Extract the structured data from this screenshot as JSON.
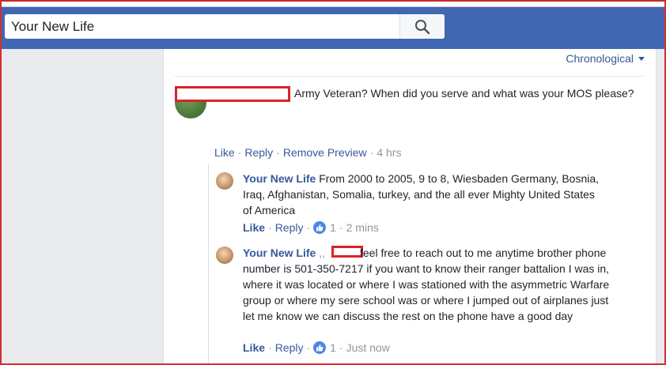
{
  "search": {
    "value": "Your New Life"
  },
  "sort": {
    "label": "Chronological"
  },
  "comment": {
    "text": "Army Veteran? When did you serve and what was your MOS please?",
    "actions": {
      "like": "Like",
      "reply": "Reply",
      "remove_preview": "Remove Preview",
      "time": "4 hrs"
    }
  },
  "replies": [
    {
      "author": "Your New Life",
      "text": "From 2000 to 2005, 9 to 8, Wiesbaden Germany, Bosnia, Iraq, Afghanistan, Somalia, turkey, and the all ever Mighty United States of America",
      "actions": {
        "like": "Like",
        "reply": "Reply",
        "count": "1",
        "time": "2 mins"
      }
    },
    {
      "author": "Your New Life",
      "prefix": ",,",
      "text": "feel free to reach out to me anytime brother phone number is 501-350-7217 if you want to know their ranger battalion I was in, where it was located or where I was stationed with the asymmetric Warfare group or where my sere school was or where I jumped out of airplanes just let me know we can discuss the rest on the phone have a good day",
      "actions": {
        "like": "Like",
        "reply": "Reply",
        "count": "1",
        "time": "Just now"
      }
    }
  ],
  "colors": {
    "topbar": "#4267b2",
    "link": "#365899",
    "redaction": "#d9232a",
    "like_badge": "#4a86e8"
  },
  "icons": [
    "search-icon",
    "chevron-down-icon",
    "thumbs-up-icon"
  ]
}
